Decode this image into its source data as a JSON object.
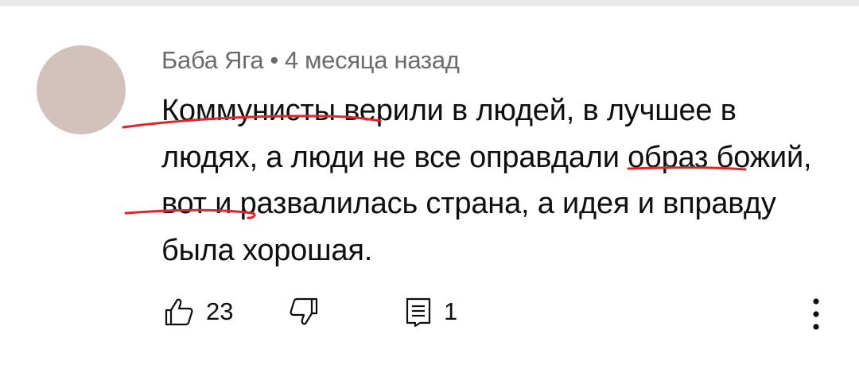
{
  "comment": {
    "author": "Баба Яга",
    "separator": "•",
    "time": "4 месяца назад",
    "text": "Коммунисты верили в людей, в лучшее в людях, а люди не все оправдали образ божий, вот и развалилась страна, а идея и вправду была хорошая.",
    "like_count": "23",
    "reply_count": "1"
  },
  "colors": {
    "annotation": "#e0262c",
    "avatar": "#d3c1bb",
    "meta_text": "#6b6b6b"
  },
  "icons": [
    "thumbs-up-icon",
    "thumbs-down-icon",
    "reply-icon",
    "more-vert-icon"
  ]
}
